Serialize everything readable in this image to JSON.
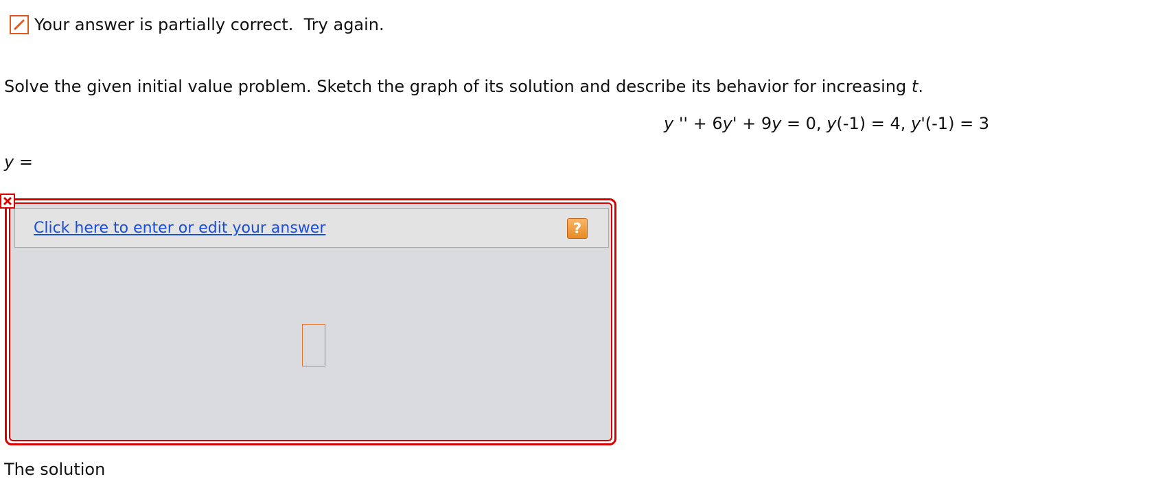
{
  "status": {
    "icon": "pencil-icon",
    "message": "Your answer is partially correct.  Try again.",
    "accent_color": "#e2581f"
  },
  "problem": {
    "prompt_before_var": "Solve the given initial value problem. Sketch the graph of its solution and describe its behavior for increasing ",
    "prompt_var": "t",
    "prompt_after_var": ".",
    "equation": {
      "y1": "y",
      "t1": " '' + 6",
      "y2": "y",
      "t2": "' + 9",
      "y3": "y",
      "t3": " = 0, ",
      "y4": "y",
      "t4": "(-1) = 4, ",
      "y5": "y",
      "t5": "'(-1) = 3"
    }
  },
  "answer": {
    "label_var": "y",
    "label_rest": " =",
    "error_icon": "close-x-icon",
    "error_color": "#d90000",
    "link_text": "Click here to enter or edit your answer",
    "help_label": "?",
    "help_icon": "question-icon"
  },
  "next_section": {
    "cutoff_text": "The solution"
  }
}
